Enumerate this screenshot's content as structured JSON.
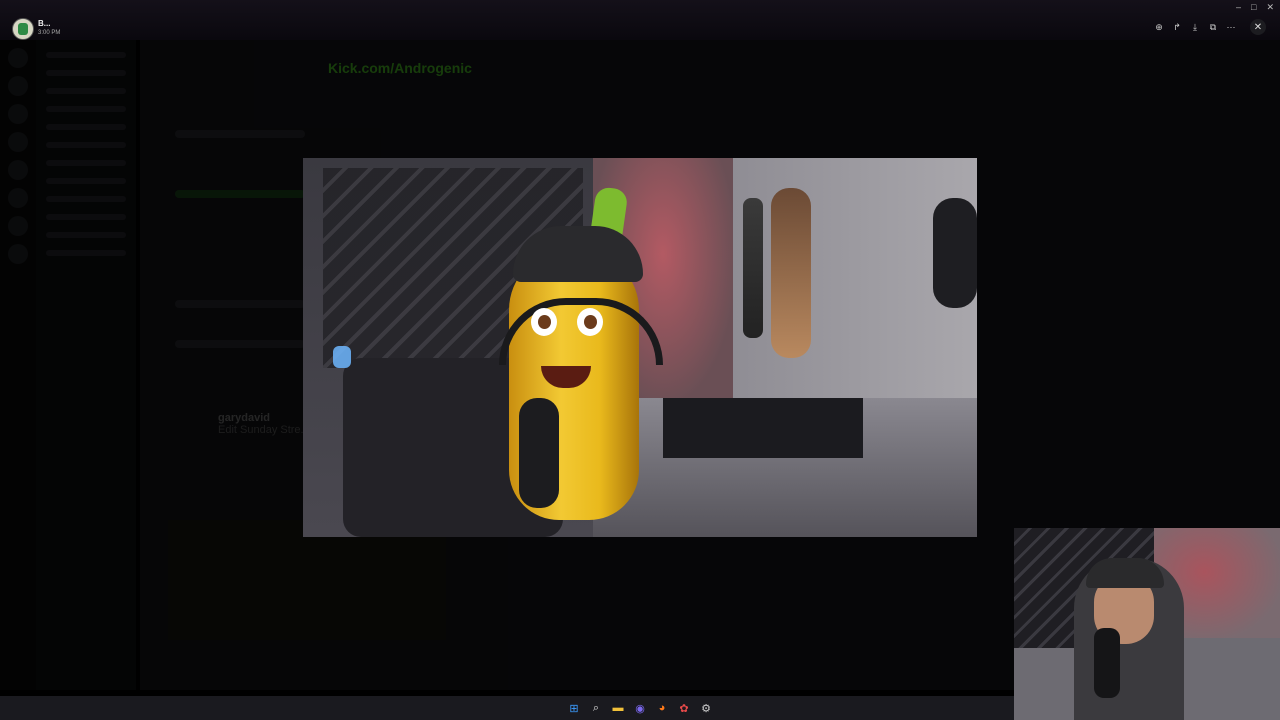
{
  "background_app": {
    "kick_url": "Kick.com/Androgenic",
    "post_author": "garydavid",
    "post_title": "Edit Sunday Stre..."
  },
  "viewer": {
    "user": {
      "name": "B...",
      "time": "3:00 PM"
    },
    "tools": [
      {
        "icon": "zoom-in-icon",
        "glyph": "⊕"
      },
      {
        "icon": "share-icon",
        "glyph": "↱"
      },
      {
        "icon": "download-icon",
        "glyph": "⤓"
      },
      {
        "icon": "open-external-icon",
        "glyph": "⧉"
      },
      {
        "icon": "more-icon",
        "glyph": "⋯"
      }
    ],
    "close_glyph": "✕",
    "window_controls": [
      "–",
      "□",
      "✕"
    ]
  },
  "taskbar": {
    "icons": [
      {
        "name": "windows-start-icon",
        "glyph": "⊞",
        "color": "#3b9cff"
      },
      {
        "name": "search-icon",
        "glyph": "⌕",
        "color": "#dddddd"
      },
      {
        "name": "file-explorer-icon",
        "glyph": "▬",
        "color": "#f2c13a"
      },
      {
        "name": "app-icon",
        "glyph": "◉",
        "color": "#7b68ee"
      },
      {
        "name": "firefox-icon",
        "glyph": "◕",
        "color": "#ff7a1a"
      },
      {
        "name": "app-icon-2",
        "glyph": "✿",
        "color": "#e84a4a"
      },
      {
        "name": "settings-icon",
        "glyph": "⚙",
        "color": "#cfcfcf"
      }
    ]
  }
}
